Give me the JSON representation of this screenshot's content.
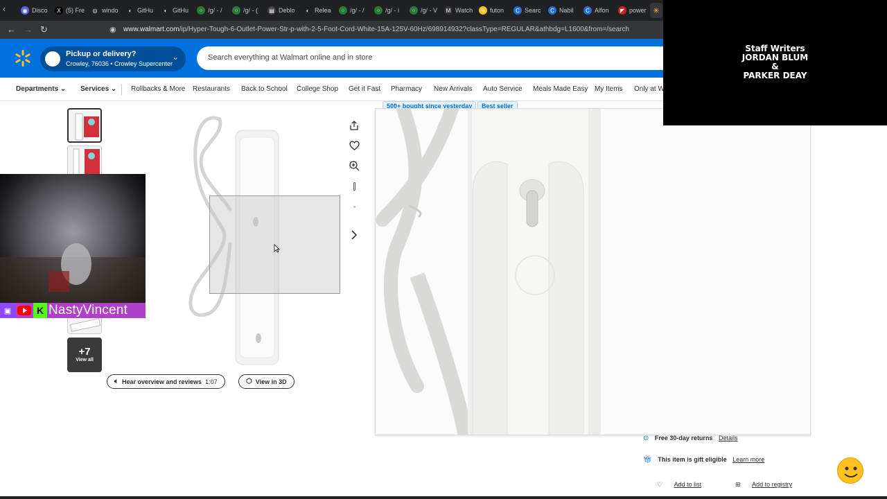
{
  "browser": {
    "tabs": [
      {
        "label": "Disco",
        "color": "#5865f2",
        "glyph": "◉"
      },
      {
        "label": "(5) Fre",
        "color": "#000000",
        "glyph": "X"
      },
      {
        "label": "windo",
        "color": "#ffffff",
        "glyph": "◎"
      },
      {
        "label": "GitHu",
        "color": "#ffffff",
        "glyph": "◐"
      },
      {
        "label": "GitHu",
        "color": "#ffffff",
        "glyph": "◐"
      },
      {
        "label": "/g/ - /",
        "color": "#2a7a3a",
        "glyph": "⁘"
      },
      {
        "label": "/g/ - (",
        "color": "#2a7a3a",
        "glyph": "⁘"
      },
      {
        "label": "Deblo",
        "color": "#444444",
        "glyph": "▤"
      },
      {
        "label": "Relea",
        "color": "#ffffff",
        "glyph": "◐"
      },
      {
        "label": "/g/ - /",
        "color": "#2a7a3a",
        "glyph": "⁘"
      },
      {
        "label": "/g/ - i",
        "color": "#2a7a3a",
        "glyph": "⁘"
      },
      {
        "label": "/g/ - V",
        "color": "#2a7a3a",
        "glyph": "⁘"
      },
      {
        "label": "Watch",
        "color": "#333333",
        "glyph": "M"
      },
      {
        "label": "futon",
        "color": "#ffc220",
        "glyph": "✳"
      },
      {
        "label": "Searc",
        "color": "#2b6cd4",
        "glyph": "C"
      },
      {
        "label": "Nabil",
        "color": "#2b6cd4",
        "glyph": "C"
      },
      {
        "label": "Alfon",
        "color": "#2b6cd4",
        "glyph": "C"
      },
      {
        "label": "power",
        "color": "#d02020",
        "glyph": "◤"
      }
    ],
    "url_domain": "www.walmart.com",
    "url_path": "/ip/Hyper-Tough-6-Outlet-Power-Str-p-with-2-5-Foot-Cord-White-15A-125V-60Hz/698914932?classType=REGULAR&athbdg=L1600&from=/search"
  },
  "header": {
    "pickup_title": "Pickup or delivery?",
    "pickup_location": "Crowley, 76036 • Crowley Supercenter",
    "search_placeholder": "Search everything at Walmart online and in store"
  },
  "nav": {
    "departments": "Departments",
    "services": "Services",
    "items": [
      "Rollbacks & More",
      "Restaurants",
      "Back to School",
      "College Shop",
      "Get it Fast",
      "Pharmacy",
      "New Arrivals",
      "Auto Service",
      "Meals Made Easy",
      "My Items",
      "Only at Wa"
    ]
  },
  "overlay": {
    "credits_line1": "Staff Writers",
    "credits_line2": "JORDAN BLUM",
    "credits_line3": "&",
    "credits_line4": "PARKER DEAY",
    "streamer_name": "NastyVincent"
  },
  "product": {
    "badge_bought": "500+ bought since yesterday",
    "badge_best": "Best seller",
    "more_images_count": "+7",
    "view_all": "View all",
    "hear_overview": "Hear overview and reviews",
    "hear_duration": "1:07",
    "view_3d": "View in 3D"
  },
  "panel": {
    "returns": "Free 30-day returns",
    "returns_link": "Details",
    "gift": "This item is gift eligible",
    "gift_link": "Learn more",
    "add_list": "Add to list",
    "add_registry": "Add to registry"
  },
  "colors": {
    "brand_blue": "#0071dc",
    "brand_yellow": "#ffc220",
    "dark_blue": "#004f9a"
  }
}
